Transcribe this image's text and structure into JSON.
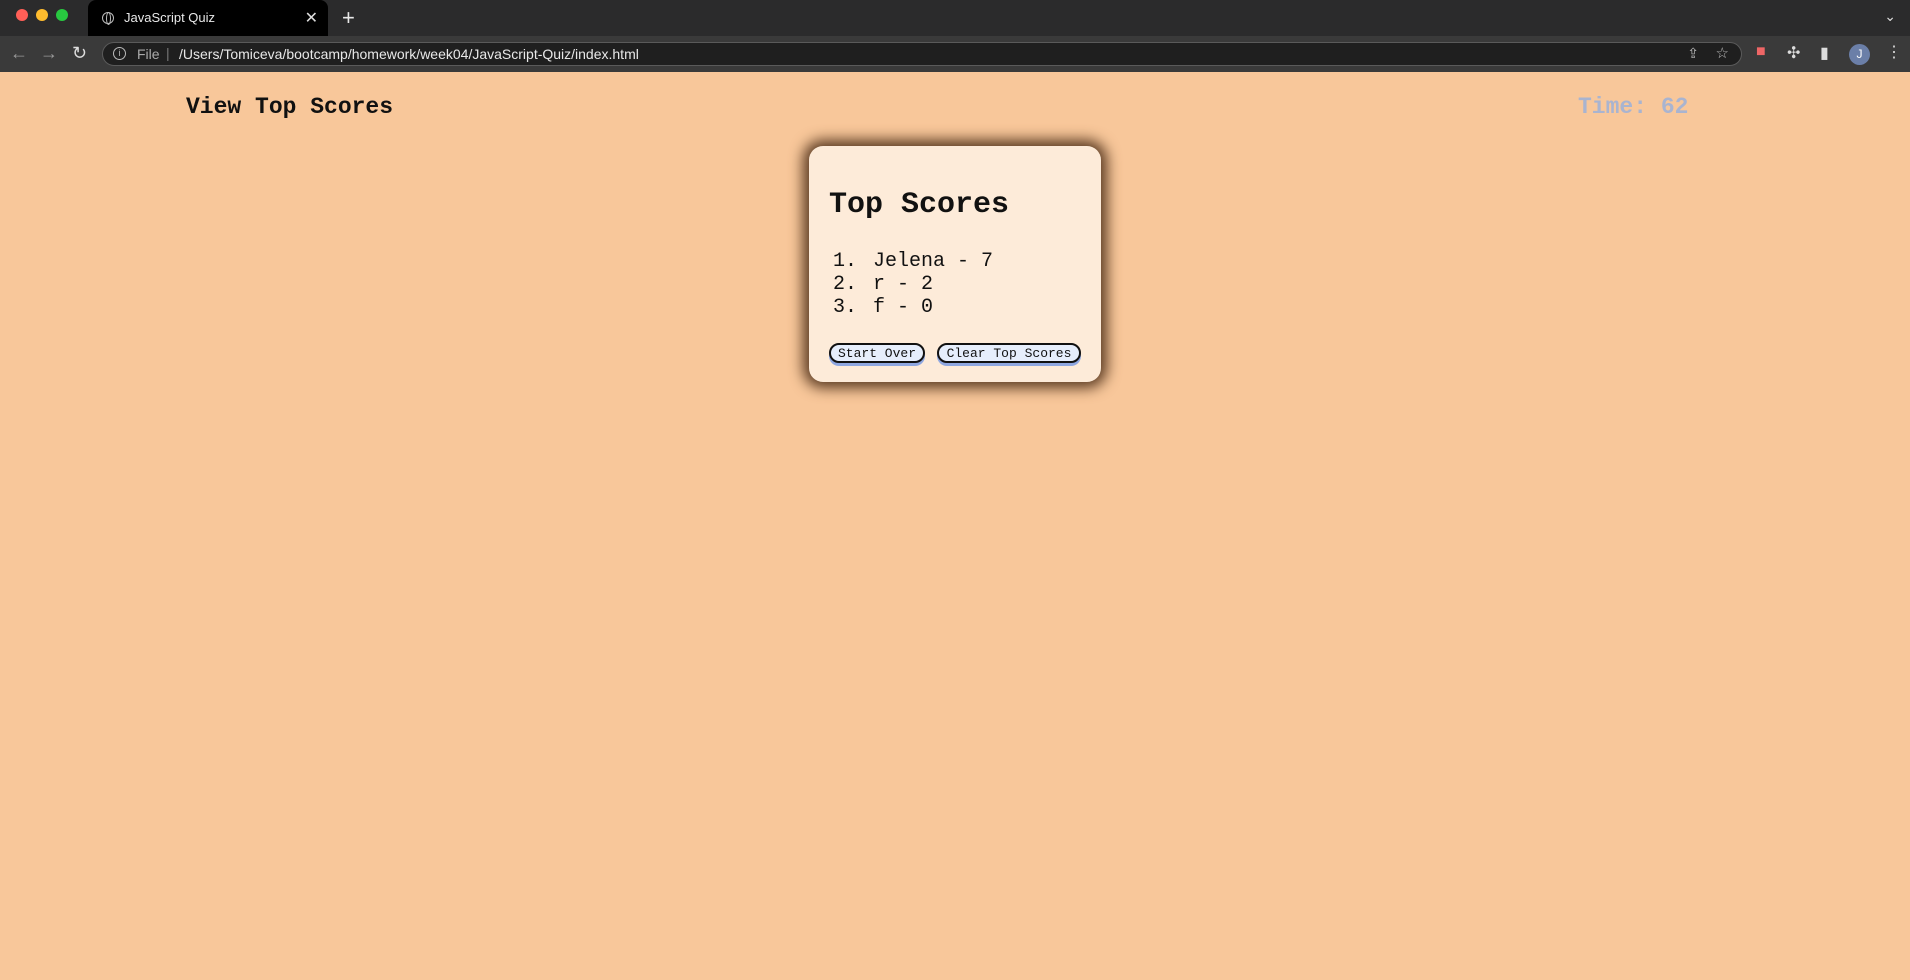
{
  "browser": {
    "tab_title": "JavaScript Quiz",
    "tab_close": "✕",
    "new_tab": "+",
    "tab_menu": "⌄",
    "back": "←",
    "forward": "→",
    "reload": "↻",
    "url_scheme": "File",
    "url_separator": "|",
    "url": "/Users/Tomiceva/bootcamp/homework/week04/JavaScript-Quiz/index.html",
    "avatar_initial": "J",
    "icons": [
      "globe-icon",
      "info-icon",
      "share-icon",
      "star-icon",
      "record-icon",
      "puzzle-icon",
      "side-panel-icon",
      "kebab-menu-icon"
    ]
  },
  "header": {
    "view_top_scores": "View Top Scores",
    "timer": "Time: 62"
  },
  "card": {
    "title": "Top Scores",
    "scores": [
      {
        "rank": "1.",
        "entry": "Jelena - 7"
      },
      {
        "rank": "2.",
        "entry": "r - 2"
      },
      {
        "rank": "3.",
        "entry": "f - 0"
      }
    ],
    "start_over_label": "Start Over",
    "clear_label": "Clear Top Scores"
  },
  "colors": {
    "page_background": "#f8c79a",
    "card_background": "#fdebd9",
    "timer_color": "#a9b4d0",
    "button_background": "#e6eefc"
  }
}
